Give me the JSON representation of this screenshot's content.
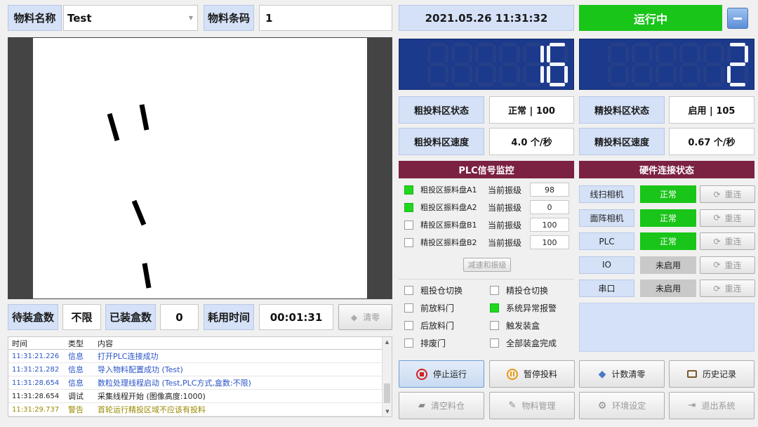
{
  "header": {
    "material_name_label": "物料名称",
    "material_name_value": "Test",
    "barcode_label": "物料条码",
    "barcode_value": "1",
    "datetime": "2021.05.26 11:31:32",
    "run_status": "运行中"
  },
  "counters": {
    "left_value": "16",
    "right_value": "2"
  },
  "status": {
    "coarse_state_label": "粗投料区状态",
    "coarse_state_value": "正常 | 100",
    "fine_state_label": "精投料区状态",
    "fine_state_value": "启用 | 105",
    "coarse_speed_label": "粗投料区速度",
    "coarse_speed_value": "4.0 个/秒",
    "fine_speed_label": "精投料区速度",
    "fine_speed_value": "0.67 个/秒"
  },
  "plc": {
    "title": "PLC信号监控",
    "vibrators": [
      {
        "name": "粗投区振料盘A1",
        "level_label": "当前振级",
        "level": "98",
        "active": true
      },
      {
        "name": "粗投区振料盘A2",
        "level_label": "当前振级",
        "level": "0",
        "active": true
      },
      {
        "name": "精投区振料盘B1",
        "level_label": "当前振级",
        "level": "100",
        "active": false
      },
      {
        "name": "精投区振料盘B2",
        "level_label": "当前振级",
        "level": "100",
        "active": false
      }
    ],
    "slow_button": "减速和振级",
    "signals": [
      {
        "name": "粗投仓切换",
        "active": false
      },
      {
        "name": "精投仓切换",
        "active": false
      },
      {
        "name": "前放料门",
        "active": false
      },
      {
        "name": "系统异常报警",
        "active": true
      },
      {
        "name": "后放料门",
        "active": false
      },
      {
        "name": "触发装盒",
        "active": false
      },
      {
        "name": "排废门",
        "active": false
      },
      {
        "name": "全部装盒完成",
        "active": false
      }
    ]
  },
  "hardware": {
    "title": "硬件连接状态",
    "reconnect_label": "重连",
    "devices": [
      {
        "name": "线扫相机",
        "state": "正常",
        "ok": true
      },
      {
        "name": "面阵相机",
        "state": "正常",
        "ok": true
      },
      {
        "name": "PLC",
        "state": "正常",
        "ok": true
      },
      {
        "name": "IO",
        "state": "未启用",
        "ok": false
      },
      {
        "name": "串口",
        "state": "未启用",
        "ok": false
      }
    ]
  },
  "boxes": {
    "pending_label": "待装盒数",
    "pending_value": "不限",
    "packed_label": "已装盒数",
    "packed_value": "0",
    "elapsed_label": "耗用时间",
    "elapsed_value": "00:01:31",
    "clear_button": "清零"
  },
  "log": {
    "columns": [
      "时间",
      "类型",
      "内容"
    ],
    "rows": [
      {
        "time": "11:31:21.226",
        "type": "信息",
        "content": "打开PLC连接成功",
        "color": "#2a54c8"
      },
      {
        "time": "11:31:21.282",
        "type": "信息",
        "content": "导入物料配置成功 (Test)",
        "color": "#2a54c8"
      },
      {
        "time": "11:31:28.654",
        "type": "信息",
        "content": "数粒处理线程启动 (Test,PLC方式,盒数:不限)",
        "color": "#2a54c8"
      },
      {
        "time": "11:31:28.654",
        "type": "调试",
        "content": "采集线程开始 (图像高度:1000)",
        "color": "#222222"
      },
      {
        "time": "11:31:29.737",
        "type": "警告",
        "content": "首轮运行精投区域不应该有投料",
        "color": "#9a8a00"
      }
    ]
  },
  "actions": {
    "stop": "停止运行",
    "pause": "暂停投料",
    "reset_count": "计数清零",
    "history": "历史记录",
    "clear_bin": "清空料仓",
    "material_mgmt": "物料管理",
    "env_settings": "环境设定",
    "exit": "退出系统"
  },
  "colors": {
    "accent_green": "#19c519",
    "dark_red": "#7b2142",
    "seg_blue": "#1c3a8c"
  }
}
